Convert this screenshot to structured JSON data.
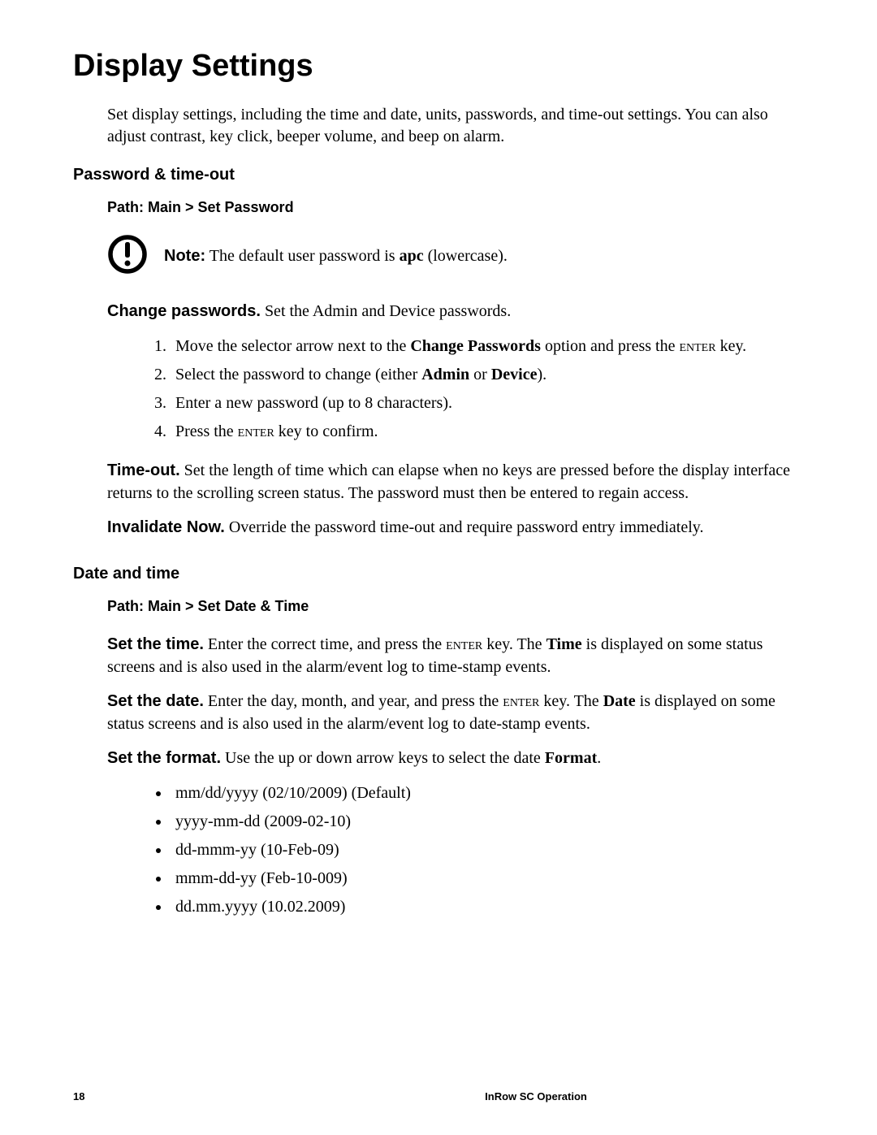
{
  "title": "Display Settings",
  "intro": "Set display settings, including the time and date, units, passwords, and time-out settings. You can also adjust contrast, key click, beeper volume, and beep on alarm.",
  "section1": {
    "heading": "Password & time-out",
    "path": "Path: Main > Set Password",
    "note_label": "Note:",
    "note_text_1": " The default user password is ",
    "note_bold": "apc",
    "note_text_2": " (lowercase).",
    "change_label": "Change passwords.",
    "change_text": " Set the Admin and Device passwords.",
    "steps": {
      "s1a": "Move the selector arrow next to the ",
      "s1b": "Change Passwords",
      "s1c": " option and press the ",
      "s1d": "enter",
      "s1e": " key.",
      "s2a": "Select the password to change (either ",
      "s2b": "Admin",
      "s2c": " or ",
      "s2d": "Device",
      "s2e": ").",
      "s3": "Enter a new password (up to 8 characters).",
      "s4a": "Press the ",
      "s4b": "enter",
      "s4c": " key to confirm."
    },
    "timeout_label": "Time-out.",
    "timeout_text": " Set the length of time which can elapse when no keys are pressed before the display interface returns to the scrolling screen status. The password must then be entered to regain access.",
    "invalidate_label": "Invalidate Now.",
    "invalidate_text": " Override the password time-out and require password entry immediately."
  },
  "section2": {
    "heading": "Date and time",
    "path": "Path: Main > Set Date & Time",
    "settime_label": "Set the time.",
    "settime_a": " Enter the correct time, and press the ",
    "settime_b": "enter",
    "settime_c": " key. The ",
    "settime_d": "Time",
    "settime_e": " is displayed on some status screens and is also used in the alarm/event log to time-stamp events.",
    "setdate_label": "Set the date.",
    "setdate_a": " Enter the day, month, and year, and press the ",
    "setdate_b": "enter",
    "setdate_c": " key. The ",
    "setdate_d": "Date",
    "setdate_e": " is displayed on some status screens and is also used in the alarm/event log to date-stamp events.",
    "setformat_label": "Set the format.",
    "setformat_a": " Use the up or down arrow keys to select the date ",
    "setformat_b": "Format",
    "setformat_c": ".",
    "formats": [
      "mm/dd/yyyy (02/10/2009) (Default)",
      "yyyy-mm-dd (2009-02-10)",
      "dd-mmm-yy (10-Feb-09)",
      "mmm-dd-yy (Feb-10-009)",
      "dd.mm.yyyy (10.02.2009)"
    ]
  },
  "footer": {
    "page": "18",
    "title": "InRow SC Operation"
  }
}
